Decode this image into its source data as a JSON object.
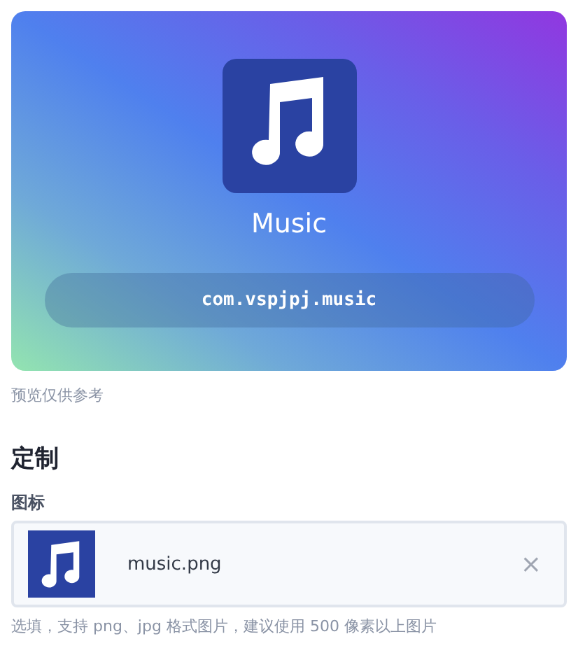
{
  "preview": {
    "app_name": "Music",
    "package_id": "com.vspjpj.music",
    "caption": "预览仅供参考"
  },
  "customize": {
    "heading": "定制",
    "icon_field": {
      "label": "图标",
      "file_name": "music.png",
      "remove": "×",
      "hint": "选填，支持 png、jpg 格式图片，建议使用 500 像素以上图片"
    }
  }
}
